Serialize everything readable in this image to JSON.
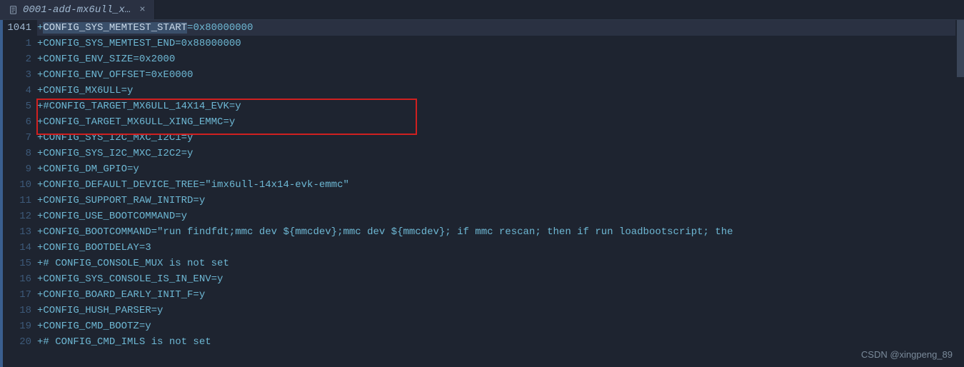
{
  "tab": {
    "filename": "0001-add-mx6ull_x…",
    "close": "×"
  },
  "gutter": {
    "start": 1041,
    "lines": [
      "1041",
      "1",
      "2",
      "3",
      "4",
      "5",
      "6",
      "7",
      "8",
      "9",
      "10",
      "11",
      "12",
      "13",
      "14",
      "15",
      "16",
      "17",
      "18",
      "19",
      "20"
    ]
  },
  "code": {
    "lines": [
      "+CONFIG_SYS_MEMTEST_START=0x80000000",
      "+CONFIG_SYS_MEMTEST_END=0x88000000",
      "+CONFIG_ENV_SIZE=0x2000",
      "+CONFIG_ENV_OFFSET=0xE0000",
      "+CONFIG_MX6ULL=y",
      "+#CONFIG_TARGET_MX6ULL_14X14_EVK=y",
      "+CONFIG_TARGET_MX6ULL_XING_EMMC=y",
      "+CONFIG_SYS_I2C_MXC_I2C1=y",
      "+CONFIG_SYS_I2C_MXC_I2C2=y",
      "+CONFIG_DM_GPIO=y",
      "+CONFIG_DEFAULT_DEVICE_TREE=\"imx6ull-14x14-evk-emmc\"",
      "+CONFIG_SUPPORT_RAW_INITRD=y",
      "+CONFIG_USE_BOOTCOMMAND=y",
      "+CONFIG_BOOTCOMMAND=\"run findfdt;mmc dev ${mmcdev};mmc dev ${mmcdev}; if mmc rescan; then if run loadbootscript; the",
      "+CONFIG_BOOTDELAY=3",
      "+# CONFIG_CONSOLE_MUX is not set",
      "+CONFIG_SYS_CONSOLE_IS_IN_ENV=y",
      "+CONFIG_BOARD_EARLY_INIT_F=y",
      "+CONFIG_HUSH_PARSER=y",
      "+CONFIG_CMD_BOOTZ=y",
      "+# CONFIG_CMD_IMLS is not set"
    ],
    "selection_line": 0,
    "selection_text": "CONFIG_SYS_MEMTEST_START"
  },
  "watermark": "CSDN @xingpeng_89"
}
